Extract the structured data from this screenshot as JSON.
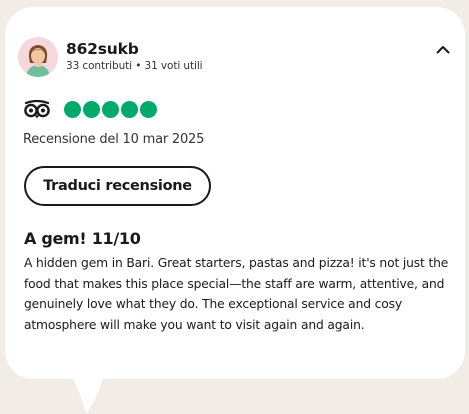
{
  "reviewer": {
    "name": "862sukb",
    "stats": "33 contributi • 31 voti utili"
  },
  "rating": {
    "value": 5,
    "max": 5,
    "color": "#00aa6c"
  },
  "review": {
    "date": "Recensione del 10 mar 2025",
    "translate_label": "Traduci recensione",
    "title": "A gem! 11/10",
    "body": "A hidden gem in Bari. Great starters, pastas and pizza! it's not just the food that makes this place special—the staff are warm, attentive, and genuinely love what they do. The exceptional service and cosy atmosphere will make you want to visit again and again."
  },
  "icons": {
    "collapse": "chevron-up-icon",
    "logo": "tripadvisor-owl-icon",
    "avatar": "user-avatar-icon"
  },
  "colors": {
    "background": "#f1ece5",
    "card": "#ffffff",
    "accent": "#00aa6c"
  }
}
